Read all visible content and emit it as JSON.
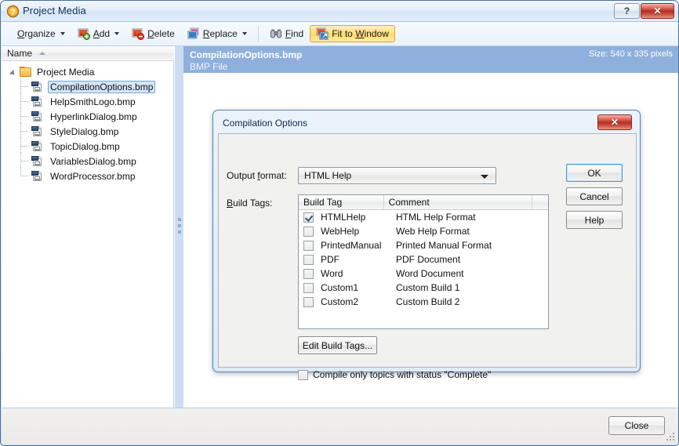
{
  "window": {
    "title": "Project Media",
    "app_icon": "help-question-icon",
    "help_button": "?",
    "close_button": "✕"
  },
  "toolbar": {
    "items": [
      {
        "label": "Organize",
        "icon": "organize-icon",
        "has_caret": true,
        "active": false
      },
      {
        "label": "Add",
        "icon": "add-image-icon",
        "has_caret": true,
        "active": false
      },
      {
        "label": "Delete",
        "icon": "delete-image-icon",
        "has_caret": false,
        "active": false
      },
      {
        "label": "Replace",
        "icon": "replace-image-icon",
        "has_caret": true,
        "active": false
      },
      {
        "label": "Find",
        "icon": "binoculars-icon",
        "has_caret": false,
        "active": false
      },
      {
        "label": "Fit to Window",
        "icon": "fit-to-window-icon",
        "has_caret": false,
        "active": true
      }
    ]
  },
  "tree": {
    "header": "Name",
    "sort_indicator": "ascending",
    "root": {
      "label": "Project Media",
      "icon": "folder-icon",
      "expanded": true
    },
    "items": [
      {
        "label": "CompilationOptions.bmp",
        "icon": "bmp-file-icon",
        "selected": true
      },
      {
        "label": "HelpSmithLogo.bmp",
        "icon": "bmp-file-icon",
        "selected": false
      },
      {
        "label": "HyperlinkDialog.bmp",
        "icon": "bmp-file-icon",
        "selected": false
      },
      {
        "label": "StyleDialog.bmp",
        "icon": "bmp-file-icon",
        "selected": false
      },
      {
        "label": "TopicDialog.bmp",
        "icon": "bmp-file-icon",
        "selected": false
      },
      {
        "label": "VariablesDialog.bmp",
        "icon": "bmp-file-icon",
        "selected": false
      },
      {
        "label": "WordProcessor.bmp",
        "icon": "bmp-file-icon",
        "selected": false
      }
    ]
  },
  "preview": {
    "file_name": "CompilationOptions.bmp",
    "file_type": "BMP File",
    "size_text": "Size: 540 x 335 pixels"
  },
  "footer": {
    "close_label": "Close"
  },
  "dialog": {
    "title": "Compilation Options",
    "close_button": "✕",
    "output_format_label": "Output format:",
    "output_format_value": "HTML Help",
    "build_tags_label": "Build Tags:",
    "columns": [
      "Build Tag",
      "Comment"
    ],
    "rows": [
      {
        "checked": true,
        "tag": "HTMLHelp",
        "comment": "HTML Help Format"
      },
      {
        "checked": false,
        "tag": "WebHelp",
        "comment": "Web Help Format"
      },
      {
        "checked": false,
        "tag": "PrintedManual",
        "comment": "Printed Manual Format"
      },
      {
        "checked": false,
        "tag": "PDF",
        "comment": "PDF Document"
      },
      {
        "checked": false,
        "tag": "Word",
        "comment": "Word Document"
      },
      {
        "checked": false,
        "tag": "Custom1",
        "comment": "Custom Build 1"
      },
      {
        "checked": false,
        "tag": "Custom2",
        "comment": "Custom Build 2"
      }
    ],
    "edit_build_tags_label": "Edit Build Tags...",
    "complete_checkbox_label": "Compile only topics with status \"Complete\"",
    "complete_checkbox_checked": false,
    "ok_label": "OK",
    "cancel_label": "Cancel",
    "help_label": "Help"
  },
  "colors": {
    "window_border": "#4a6f9b",
    "preview_header": "#8fb0dd",
    "selection": "#d4e6f8",
    "toolbar_active": "#ffe181",
    "close_red": "#b32e22",
    "folder_gold": "#f6b73c"
  }
}
